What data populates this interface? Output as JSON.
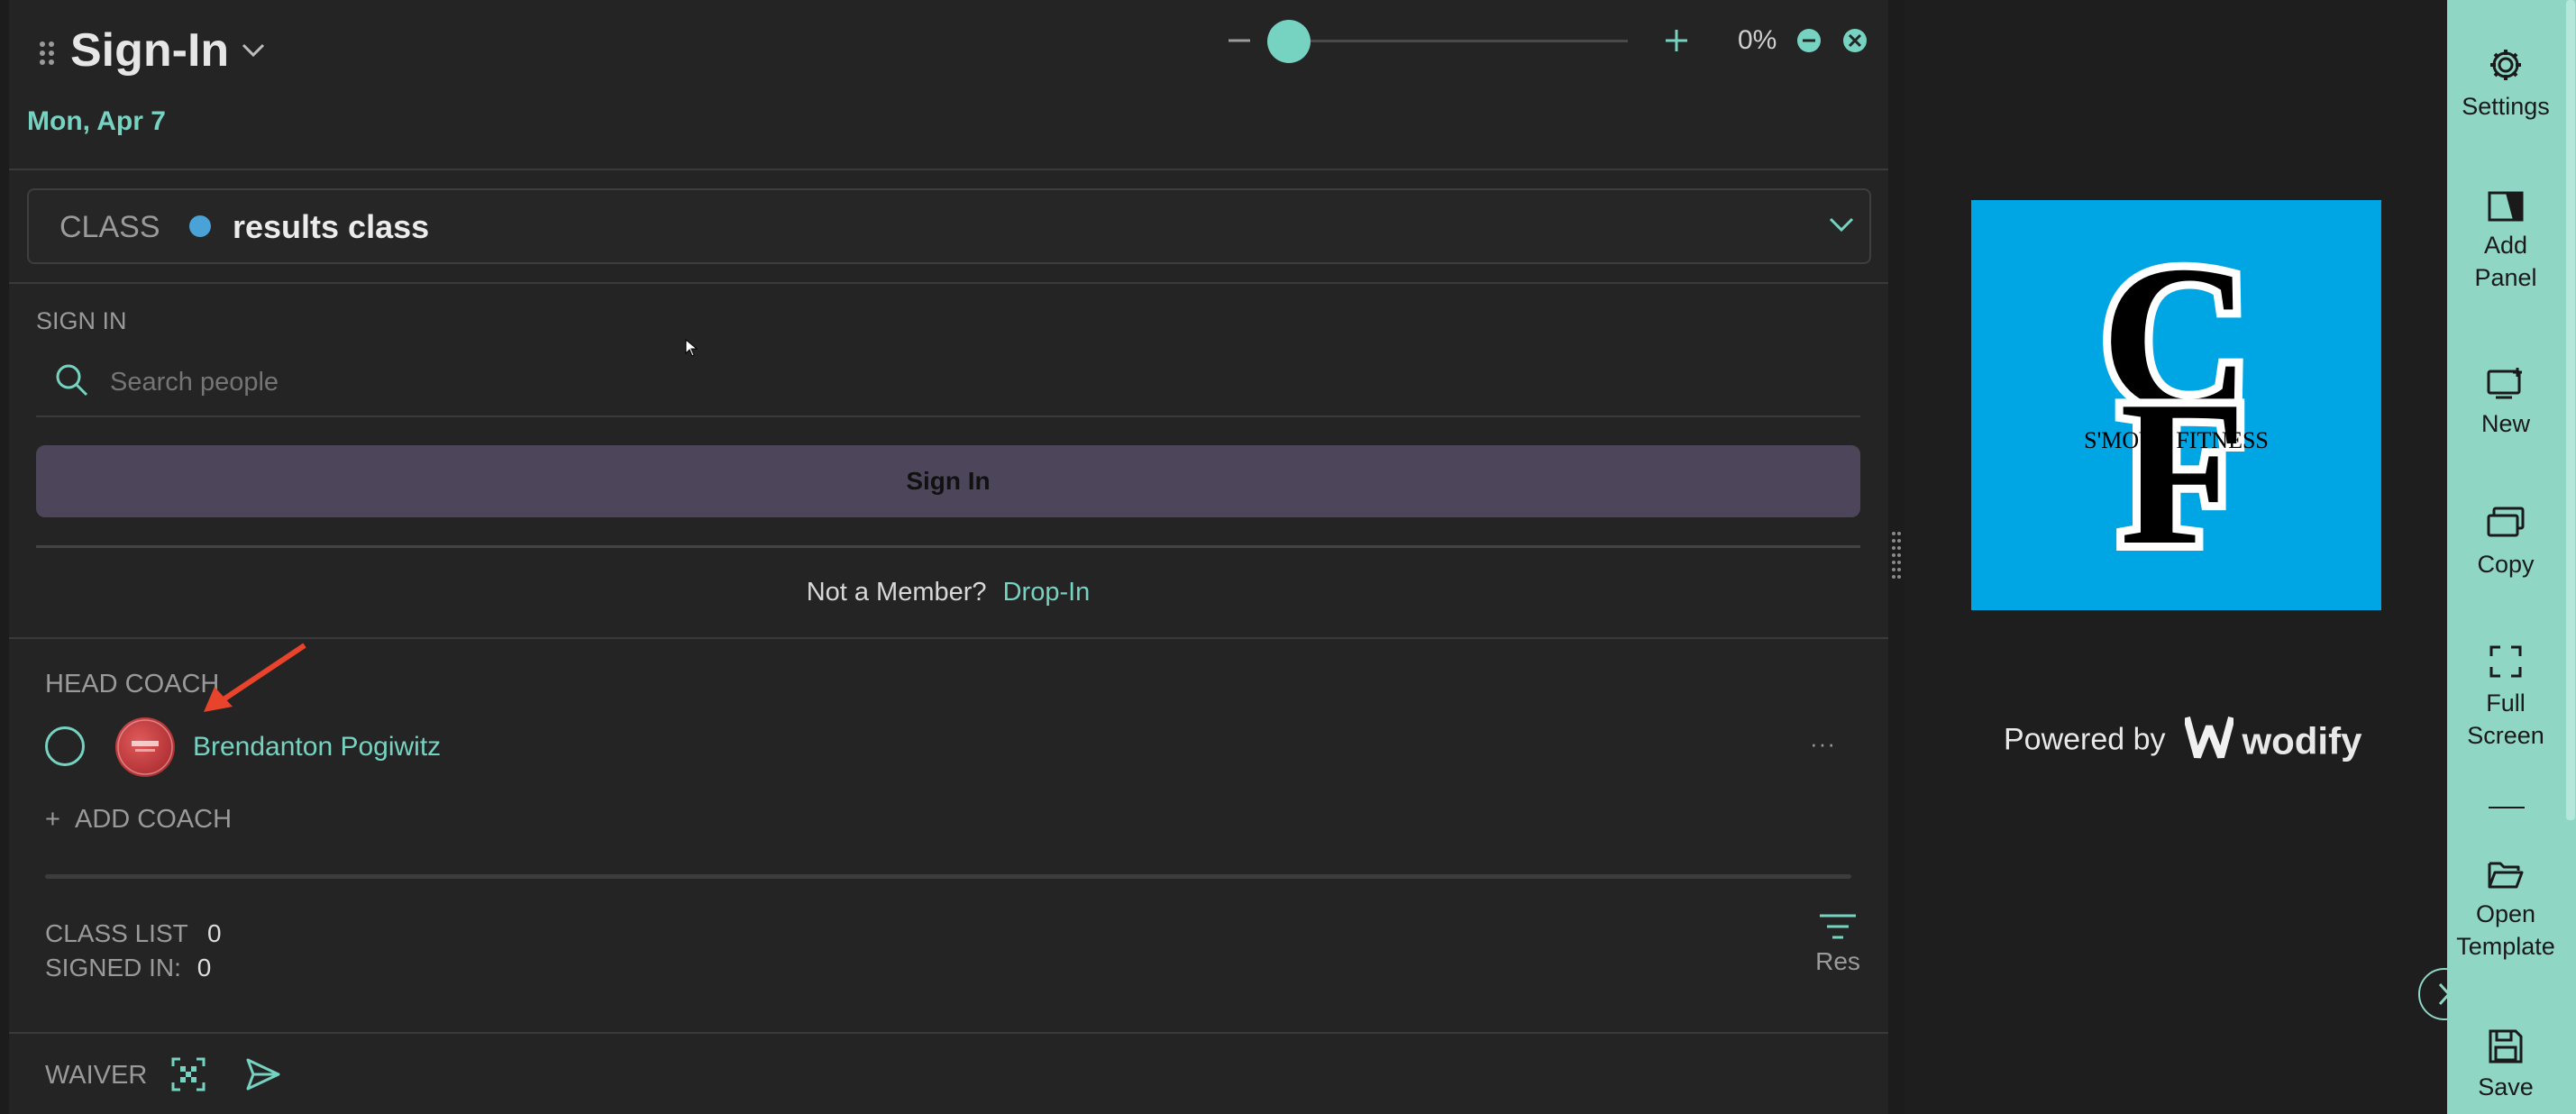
{
  "header": {
    "title": "Sign-In",
    "date": "Mon, Apr 7",
    "zoom_percent": "0%",
    "zoom_level": 0
  },
  "class_selector": {
    "label": "CLASS",
    "value": "results class",
    "dot_color": "#4aa3d6"
  },
  "sign_in": {
    "section_label": "SIGN IN",
    "search_placeholder": "Search people",
    "button_label": "Sign In",
    "not_member_text": "Not a Member?",
    "drop_in_link": "Drop-In"
  },
  "head_coach": {
    "section_label": "HEAD COACH",
    "coach_name": "Brendanton Pogiwitz",
    "more_label": "···",
    "add_coach_label": "ADD COACH"
  },
  "class_list": {
    "class_list_label": "CLASS LIST",
    "class_list_count": "0",
    "signed_in_label": "SIGNED IN:",
    "signed_in_count": "0",
    "sort_label": "Res"
  },
  "footer": {
    "waiver_label": "WAIVER"
  },
  "brand": {
    "logo_text": "S'MOVE FITNESS",
    "logo_bg": "#00a5e3",
    "powered_by": "Powered by",
    "wodify": "wodify"
  },
  "toolbar": {
    "settings": "Settings",
    "add_panel_1": "Add",
    "add_panel_2": "Panel",
    "new": "New",
    "copy": "Copy",
    "full_screen_1": "Full",
    "full_screen_2": "Screen",
    "open_template_1": "Open",
    "open_template_2": "Template",
    "save": "Save"
  },
  "colors": {
    "accent": "#76d3c1",
    "annotation_arrow": "#e8432b",
    "button_bg": "#4d4559"
  }
}
